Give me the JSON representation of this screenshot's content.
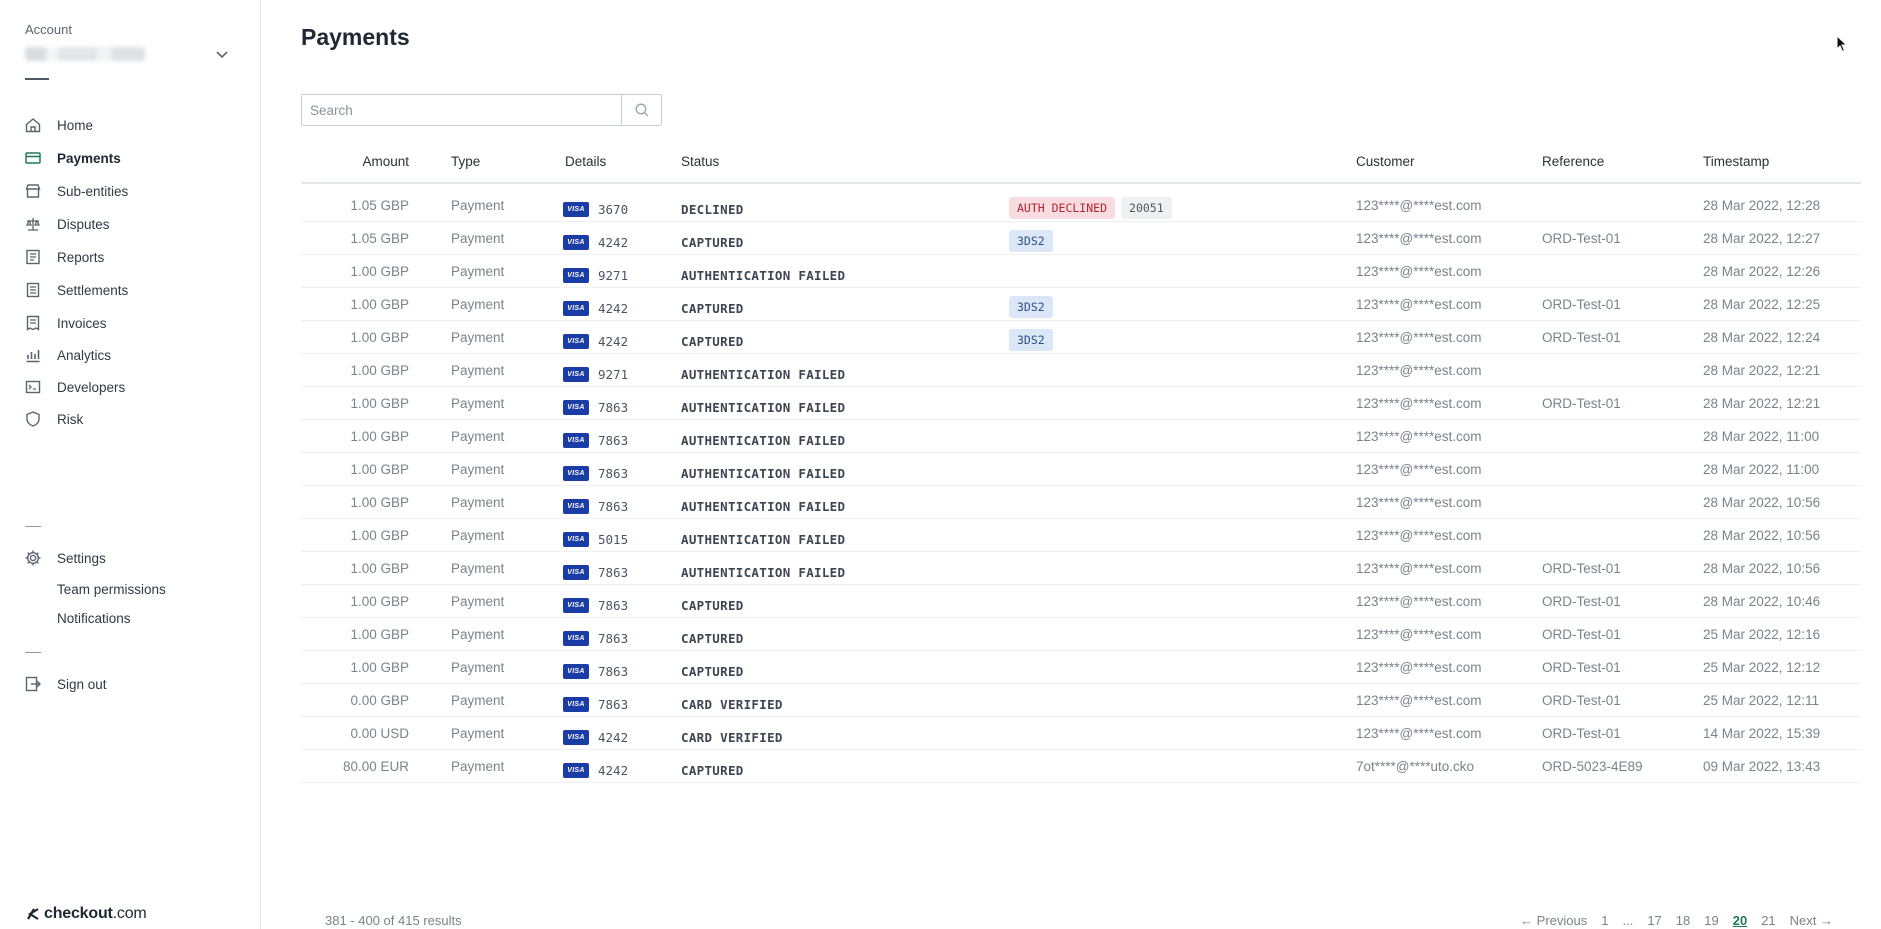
{
  "sidebar": {
    "account_label": "Account",
    "nav": [
      {
        "label": "Home",
        "icon": "home-icon"
      },
      {
        "label": "Payments",
        "icon": "payments-icon"
      },
      {
        "label": "Sub-entities",
        "icon": "store-icon"
      },
      {
        "label": "Disputes",
        "icon": "scale-icon"
      },
      {
        "label": "Reports",
        "icon": "reports-icon"
      },
      {
        "label": "Settlements",
        "icon": "settlements-icon"
      },
      {
        "label": "Invoices",
        "icon": "invoices-icon"
      },
      {
        "label": "Analytics",
        "icon": "analytics-icon"
      },
      {
        "label": "Developers",
        "icon": "developers-icon"
      },
      {
        "label": "Risk",
        "icon": "shield-icon"
      }
    ],
    "settings": {
      "label": "Settings",
      "icon": "gear-icon"
    },
    "sub_items": [
      "Team permissions",
      "Notifications"
    ],
    "sign_out": {
      "label": "Sign out",
      "icon": "signout-icon"
    },
    "brand": {
      "bold": "checkout",
      "rest": ".com"
    }
  },
  "main": {
    "title": "Payments",
    "search": {
      "placeholder": "Search",
      "value": ""
    },
    "columns": [
      "Amount",
      "Type",
      "Details",
      "Status",
      "Customer",
      "Reference",
      "Timestamp"
    ],
    "rows": [
      {
        "amount": "1.05 GBP",
        "type": "Payment",
        "last4": "3670",
        "status": "DECLINED",
        "tags": [
          {
            "text": "AUTH DECLINED",
            "kind": "red"
          },
          {
            "text": "20051",
            "kind": "grey"
          }
        ],
        "customer": "123****@****est.com",
        "reference": "",
        "timestamp": "28 Mar 2022, 12:28"
      },
      {
        "amount": "1.05 GBP",
        "type": "Payment",
        "last4": "4242",
        "status": "CAPTURED",
        "tags": [
          {
            "text": "3DS2",
            "kind": "blue"
          }
        ],
        "customer": "123****@****est.com",
        "reference": "ORD-Test-01",
        "timestamp": "28 Mar 2022, 12:27"
      },
      {
        "amount": "1.00 GBP",
        "type": "Payment",
        "last4": "9271",
        "status": "AUTHENTICATION FAILED",
        "tags": [],
        "customer": "123****@****est.com",
        "reference": "",
        "timestamp": "28 Mar 2022, 12:26"
      },
      {
        "amount": "1.00 GBP",
        "type": "Payment",
        "last4": "4242",
        "status": "CAPTURED",
        "tags": [
          {
            "text": "3DS2",
            "kind": "blue"
          }
        ],
        "customer": "123****@****est.com",
        "reference": "ORD-Test-01",
        "timestamp": "28 Mar 2022, 12:25"
      },
      {
        "amount": "1.00 GBP",
        "type": "Payment",
        "last4": "4242",
        "status": "CAPTURED",
        "tags": [
          {
            "text": "3DS2",
            "kind": "blue"
          }
        ],
        "customer": "123****@****est.com",
        "reference": "ORD-Test-01",
        "timestamp": "28 Mar 2022, 12:24"
      },
      {
        "amount": "1.00 GBP",
        "type": "Payment",
        "last4": "9271",
        "status": "AUTHENTICATION FAILED",
        "tags": [],
        "customer": "123****@****est.com",
        "reference": "",
        "timestamp": "28 Mar 2022, 12:21"
      },
      {
        "amount": "1.00 GBP",
        "type": "Payment",
        "last4": "7863",
        "status": "AUTHENTICATION FAILED",
        "tags": [],
        "customer": "123****@****est.com",
        "reference": "ORD-Test-01",
        "timestamp": "28 Mar 2022, 12:21"
      },
      {
        "amount": "1.00 GBP",
        "type": "Payment",
        "last4": "7863",
        "status": "AUTHENTICATION FAILED",
        "tags": [],
        "customer": "123****@****est.com",
        "reference": "",
        "timestamp": "28 Mar 2022, 11:00"
      },
      {
        "amount": "1.00 GBP",
        "type": "Payment",
        "last4": "7863",
        "status": "AUTHENTICATION FAILED",
        "tags": [],
        "customer": "123****@****est.com",
        "reference": "",
        "timestamp": "28 Mar 2022, 11:00"
      },
      {
        "amount": "1.00 GBP",
        "type": "Payment",
        "last4": "7863",
        "status": "AUTHENTICATION FAILED",
        "tags": [],
        "customer": "123****@****est.com",
        "reference": "",
        "timestamp": "28 Mar 2022, 10:56"
      },
      {
        "amount": "1.00 GBP",
        "type": "Payment",
        "last4": "5015",
        "status": "AUTHENTICATION FAILED",
        "tags": [],
        "customer": "123****@****est.com",
        "reference": "",
        "timestamp": "28 Mar 2022, 10:56"
      },
      {
        "amount": "1.00 GBP",
        "type": "Payment",
        "last4": "7863",
        "status": "AUTHENTICATION FAILED",
        "tags": [],
        "customer": "123****@****est.com",
        "reference": "ORD-Test-01",
        "timestamp": "28 Mar 2022, 10:56"
      },
      {
        "amount": "1.00 GBP",
        "type": "Payment",
        "last4": "7863",
        "status": "CAPTURED",
        "tags": [],
        "customer": "123****@****est.com",
        "reference": "ORD-Test-01",
        "timestamp": "28 Mar 2022, 10:46"
      },
      {
        "amount": "1.00 GBP",
        "type": "Payment",
        "last4": "7863",
        "status": "CAPTURED",
        "tags": [],
        "customer": "123****@****est.com",
        "reference": "ORD-Test-01",
        "timestamp": "25 Mar 2022, 12:16"
      },
      {
        "amount": "1.00 GBP",
        "type": "Payment",
        "last4": "7863",
        "status": "CAPTURED",
        "tags": [],
        "customer": "123****@****est.com",
        "reference": "ORD-Test-01",
        "timestamp": "25 Mar 2022, 12:12"
      },
      {
        "amount": "0.00 GBP",
        "type": "Payment",
        "last4": "7863",
        "status": "CARD VERIFIED",
        "tags": [],
        "customer": "123****@****est.com",
        "reference": "ORD-Test-01",
        "timestamp": "25 Mar 2022, 12:11"
      },
      {
        "amount": "0.00 USD",
        "type": "Payment",
        "last4": "4242",
        "status": "CARD VERIFIED",
        "tags": [],
        "customer": "123****@****est.com",
        "reference": "ORD-Test-01",
        "timestamp": "14 Mar 2022, 15:39"
      },
      {
        "amount": "80.00 EUR",
        "type": "Payment",
        "last4": "4242",
        "status": "CAPTURED",
        "tags": [],
        "customer": "7ot****@****uto.cko",
        "reference": "ORD-5023-4E89",
        "timestamp": "09 Mar 2022, 13:43"
      }
    ],
    "card_brand": "VISA",
    "footer": {
      "results": "381 - 400 of 415 results",
      "previous": "← Previous",
      "pages": [
        "1",
        "...",
        "17",
        "18",
        "19",
        "20",
        "21"
      ],
      "current_page": "20",
      "next": "Next →"
    }
  }
}
